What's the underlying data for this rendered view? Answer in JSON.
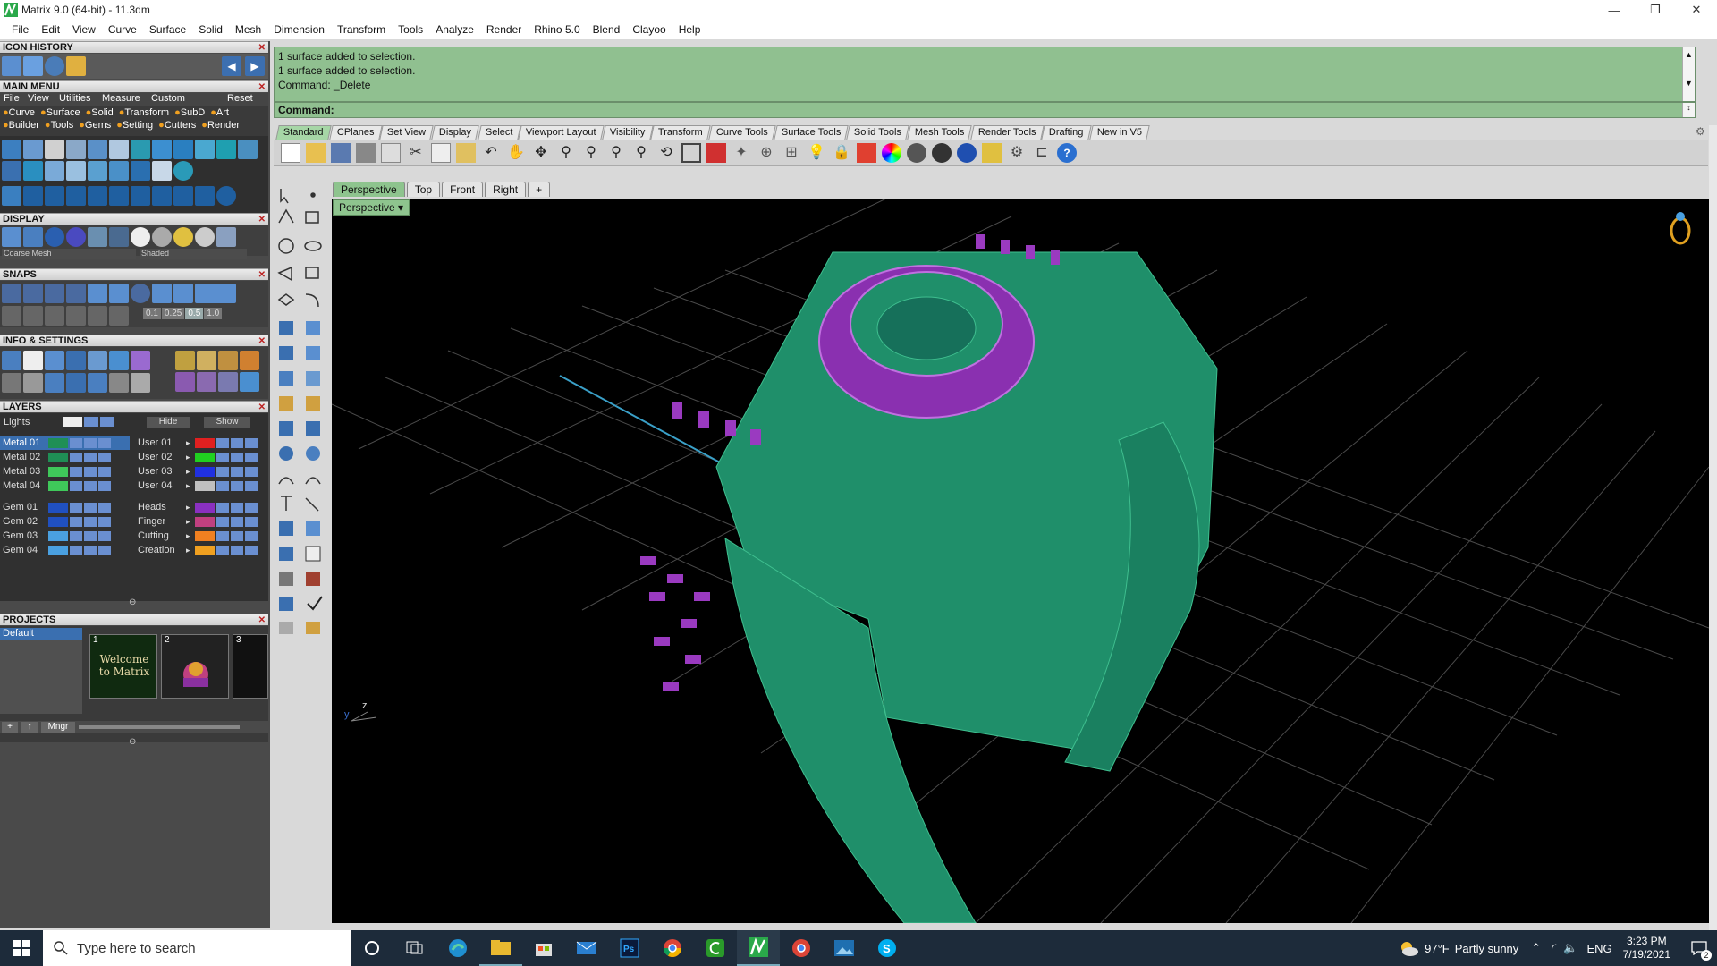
{
  "window": {
    "title": "Matrix 9.0 (64-bit) - 11.3dm",
    "min": "—",
    "max": "❐",
    "close": "✕"
  },
  "menubar": [
    "File",
    "Edit",
    "View",
    "Curve",
    "Surface",
    "Solid",
    "Mesh",
    "Dimension",
    "Transform",
    "Tools",
    "Analyze",
    "Render",
    "Rhino 5.0",
    "Blend",
    "Clayoo",
    "Help"
  ],
  "left": {
    "icon_history": "ICON HISTORY",
    "main_menu": "MAIN MENU",
    "main_menu_items": [
      "File",
      "View",
      "Utilities",
      "Measure",
      "Custom",
      "Reset"
    ],
    "categories1": [
      "Curve",
      "Surface",
      "Solid",
      "Transform",
      "SubD",
      "Art"
    ],
    "categories2": [
      "Builder",
      "Tools",
      "Gems",
      "Setting",
      "Cutters",
      "Render"
    ],
    "display": "DISPLAY",
    "display_mesh": "Coarse Mesh",
    "display_mode": "Shaded",
    "snaps": "SNAPS",
    "snap_values": [
      "0.1",
      "0.25",
      "0.5",
      "1.0"
    ],
    "info": "INFO & SETTINGS",
    "layers": "LAYERS",
    "lights": "Lights",
    "hide": "Hide",
    "show": "Show",
    "layers_left": [
      "Metal 01",
      "Metal 02",
      "Metal 03",
      "Metal 04",
      "Gem 01",
      "Gem 02",
      "Gem 03",
      "Gem 04"
    ],
    "layers_right": [
      "User 01",
      "User 02",
      "User 03",
      "User 04",
      "Heads",
      "Finger",
      "Cutting",
      "Creation"
    ],
    "layer_colors_left": [
      "#1f8f55",
      "#1f8f55",
      "#3fc85a",
      "#3fc85a",
      "#2050c0",
      "#2050c0",
      "#4aa0e0",
      "#4aa0e0"
    ],
    "layer_colors_right": [
      "#e02020",
      "#20d020",
      "#2030e0",
      "#c0c0c0",
      "#8a30c0",
      "#c04080",
      "#f08020",
      "#f0a020"
    ],
    "projects": "PROJECTS",
    "project_default": "Default",
    "project_thumb_nums": [
      "1",
      "2",
      "3"
    ],
    "welcome_text": "Welcome to Matrix",
    "mngr": "Mngr"
  },
  "command": {
    "history": [
      "1 surface added to selection.",
      "1 surface added to selection.",
      "Command: _Delete"
    ],
    "prompt": "Command:"
  },
  "tabs": [
    "Standard",
    "CPlanes",
    "Set View",
    "Display",
    "Select",
    "Viewport Layout",
    "Visibility",
    "Transform",
    "Curve Tools",
    "Surface Tools",
    "Solid Tools",
    "Mesh Tools",
    "Render Tools",
    "Drafting",
    "New in V5"
  ],
  "viewport": {
    "tabs": [
      "Perspective",
      "Top",
      "Front",
      "Right",
      "+"
    ],
    "label": "Perspective",
    "axis_y": "y",
    "axis_z": "z"
  },
  "taskbar": {
    "search": "Type here to search",
    "weather_temp": "97°F",
    "weather_text": "Partly sunny",
    "lang": "ENG",
    "time": "3:23 PM",
    "date": "7/19/2021",
    "notif": "2"
  }
}
